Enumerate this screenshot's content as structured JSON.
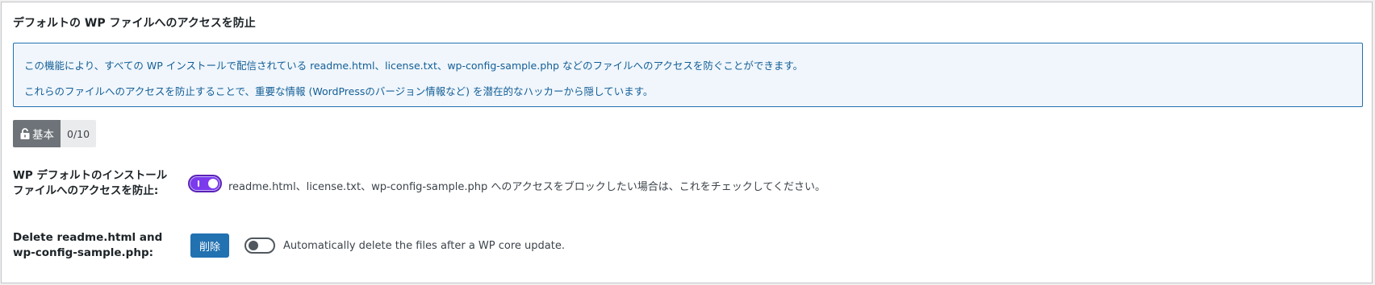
{
  "panel": {
    "title": "デフォルトの WP ファイルへのアクセスを防止"
  },
  "notice": {
    "line1": "この機能により、すべての WP インストールで配信されている readme.html、license.txt、wp-config-sample.php などのファイルへのアクセスを防ぐことができます。",
    "line2": "これらのファイルへのアクセスを防止することで、重要な情報 (WordPressのバージョン情報など) を潜在的なハッカーから隠しています。"
  },
  "badge": {
    "icon": "unlock-icon",
    "label": "基本",
    "count": "0/10"
  },
  "setting_block": {
    "label": "WP デフォルトのインストールファイルへのアクセスを防止:",
    "enabled": true,
    "description": "readme.html、license.txt、wp-config-sample.php へのアクセスをブロックしたい場合は、これをチェックしてください。"
  },
  "setting_delete": {
    "label": "Delete readme.html and wp-config-sample.php:",
    "button_label": "削除",
    "auto_delete_enabled": false,
    "description": "Automatically delete the files after a WP core update."
  },
  "colors": {
    "accent": "#2271b1",
    "toggle_on": "#7c3aed",
    "notice_bg": "#f0f6fc"
  }
}
